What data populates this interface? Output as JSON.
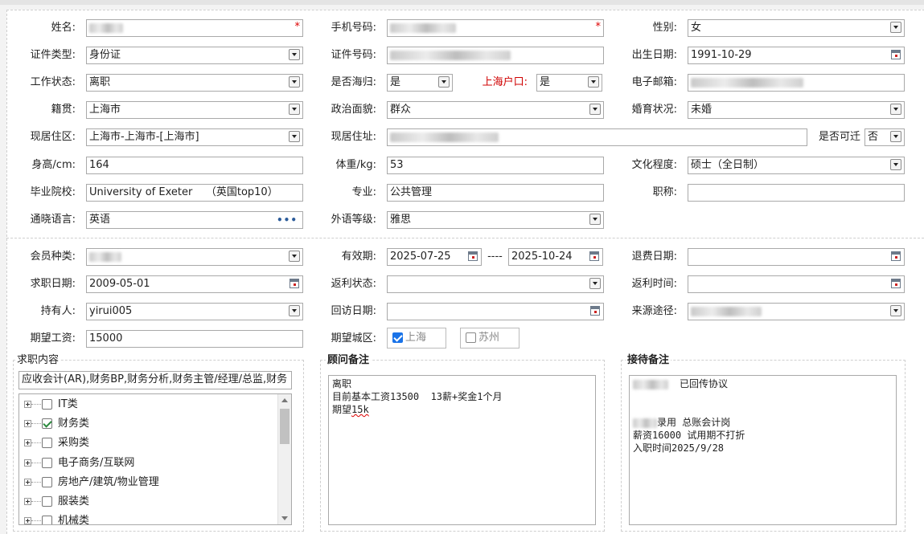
{
  "form": {
    "name": {
      "label": "姓名:",
      "value": ""
    },
    "phone": {
      "label": "手机号码:",
      "value": ""
    },
    "gender": {
      "label": "性别:",
      "value": "女"
    },
    "id_type": {
      "label": "证件类型:",
      "value": "身份证"
    },
    "id_number": {
      "label": "证件号码:",
      "value": ""
    },
    "birth_date": {
      "label": "出生日期:",
      "value": "1991-10-29"
    },
    "work_status": {
      "label": "工作状态:",
      "value": "离职"
    },
    "returnee": {
      "label": "是否海归:",
      "value": "是"
    },
    "shanghai_hukou": {
      "label": "上海户口:",
      "value": "是"
    },
    "email": {
      "label": "电子邮箱:",
      "value": ""
    },
    "native_place": {
      "label": "籍贯:",
      "value": "上海市"
    },
    "political_status": {
      "label": "政治面貌:",
      "value": "群众"
    },
    "marital_status": {
      "label": "婚育状况:",
      "value": "未婚"
    },
    "residence_area": {
      "label": "现居住区:",
      "value": "上海市-上海市-[上海市]"
    },
    "address": {
      "label": "现居住址:",
      "value": ""
    },
    "relocate": {
      "label": "是否可迁",
      "value": "否"
    },
    "height": {
      "label": "身高/cm:",
      "value": "164"
    },
    "weight": {
      "label": "体重/kg:",
      "value": "53"
    },
    "education": {
      "label": "文化程度:",
      "value": "硕士（全日制）"
    },
    "school": {
      "label": "毕业院校:",
      "value": "University of Exeter    （英国top10）"
    },
    "major": {
      "label": "专业:",
      "value": "公共管理"
    },
    "title": {
      "label": "职称:",
      "value": ""
    },
    "languages": {
      "label": "通晓语言:",
      "value": "英语"
    },
    "language_level": {
      "label": "外语等级:",
      "value": "雅思"
    }
  },
  "member": {
    "member_type": {
      "label": "会员种类:",
      "value": ""
    },
    "valid_period": {
      "label": "有效期:",
      "start": "2025-07-25",
      "separator": "----",
      "end": "2025-10-24"
    },
    "refund_date": {
      "label": "退费日期:",
      "value": ""
    },
    "job_seek_date": {
      "label": "求职日期:",
      "value": "2009-05-01"
    },
    "rebate_status": {
      "label": "返利状态:",
      "value": ""
    },
    "rebate_time": {
      "label": "返利时间:",
      "value": ""
    },
    "holder": {
      "label": "持有人:",
      "value": "yirui005"
    },
    "revisit_date": {
      "label": "回访日期:",
      "value": ""
    },
    "source": {
      "label": "来源途径:",
      "value": ""
    },
    "expected_salary": {
      "label": "期望工资:",
      "value": "15000"
    },
    "expected_city": {
      "label": "期望城区:",
      "options": [
        {
          "label": "上海",
          "checked": true
        },
        {
          "label": "苏州",
          "checked": false
        }
      ]
    }
  },
  "job_content": {
    "title": "求职内容",
    "summary": "应收会计(AR),财务BP,财务分析,财务主管/经理/总监,财务",
    "tree": [
      {
        "label": "IT类",
        "checked": false
      },
      {
        "label": "财务类",
        "checked": true
      },
      {
        "label": "采购类",
        "checked": false
      },
      {
        "label": "电子商务/互联网",
        "checked": false
      },
      {
        "label": "房地产/建筑/物业管理",
        "checked": false
      },
      {
        "label": "服装类",
        "checked": false
      },
      {
        "label": "机械类",
        "checked": false
      }
    ]
  },
  "advisor_note": {
    "title": "顾问备注",
    "line1": "离职",
    "line2": "目前基本工资13500  13薪+奖金1个月",
    "line3_prefix": "期望",
    "line3_word": "15k"
  },
  "reception_note": {
    "title": "接待备注",
    "line1": "已回传协议",
    "line2": "录用 总账会计岗",
    "line3": "薪资16000 试用期不打折",
    "line4": "入职时间2025/9/28"
  }
}
